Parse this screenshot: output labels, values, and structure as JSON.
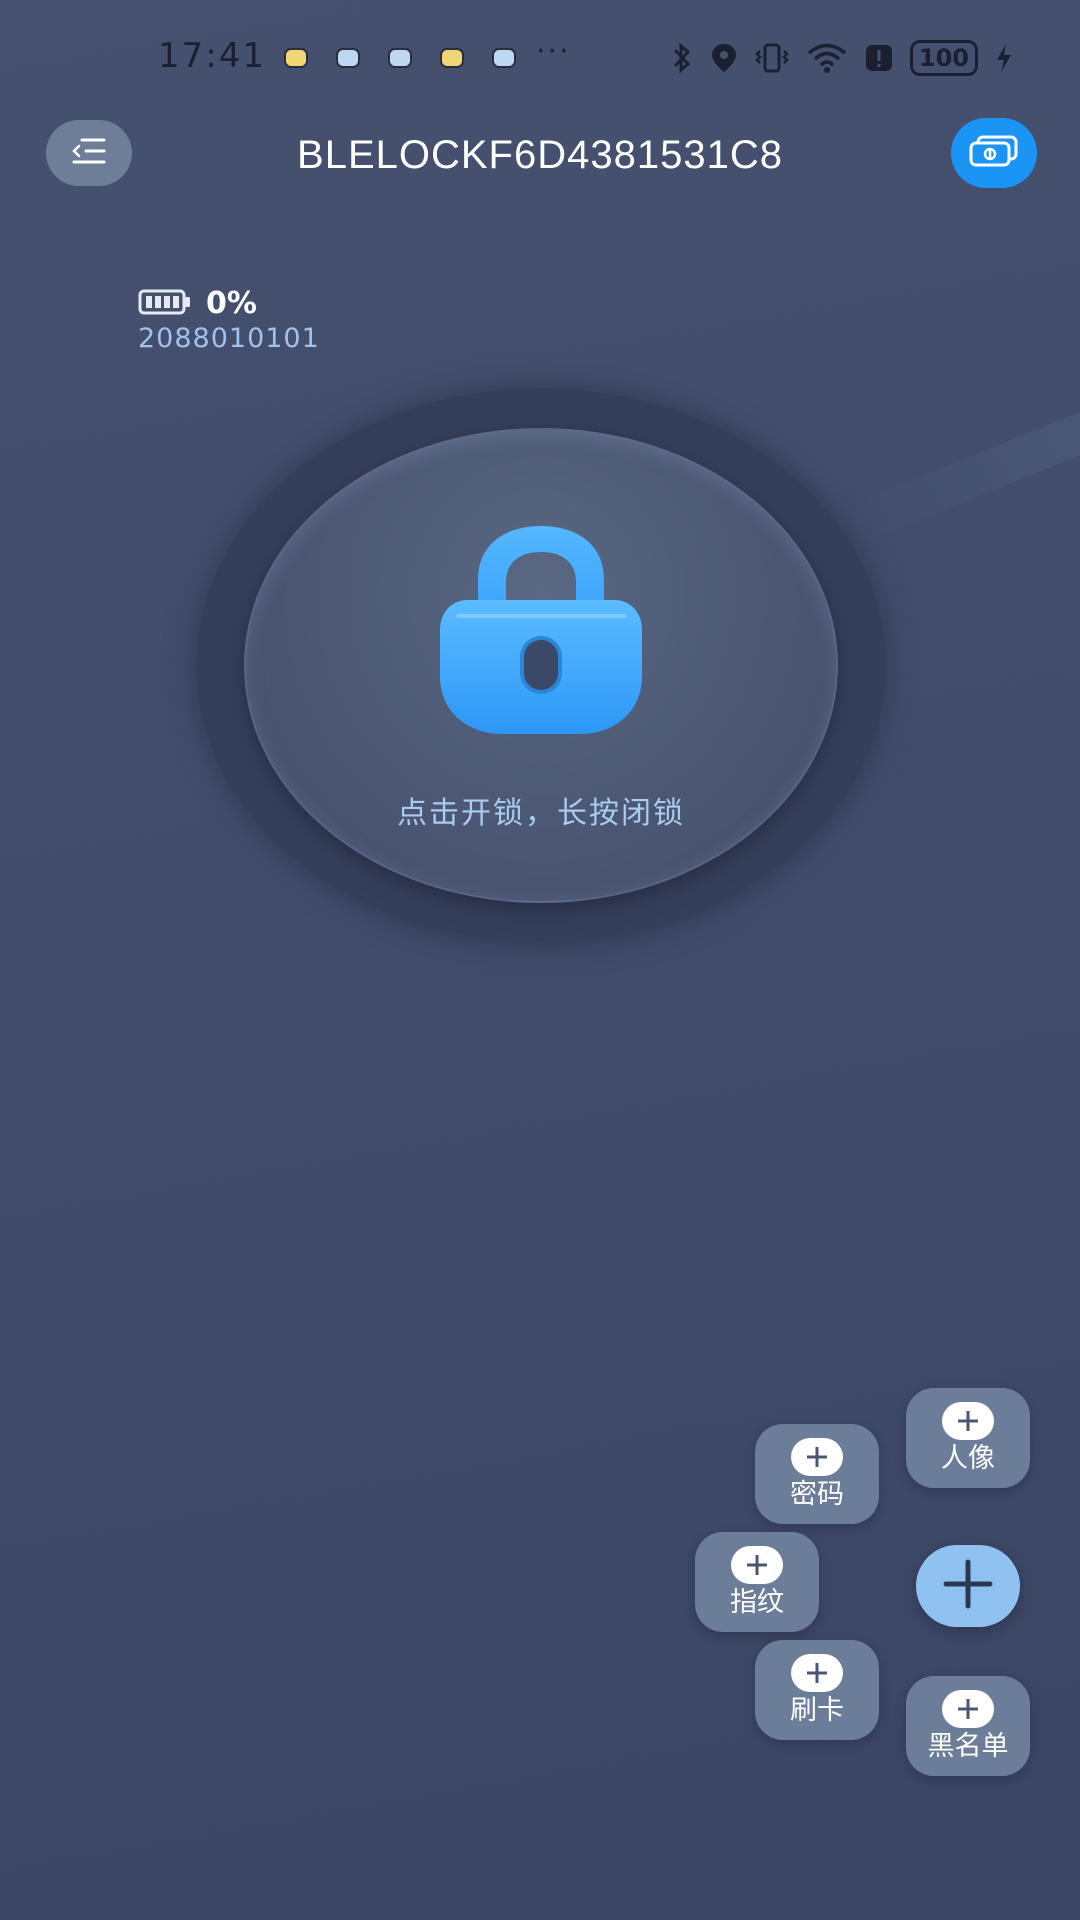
{
  "status_bar": {
    "time": "17:41",
    "more": "···",
    "battery_level": "100"
  },
  "header": {
    "title": "BLELOCKF6D4381531C8",
    "menu_icon": "menu-list-icon",
    "switch_icon": "switch-device-icon"
  },
  "device": {
    "battery_percent": "0%",
    "battery_icon": "battery-icon",
    "number": "2088010101"
  },
  "lock": {
    "icon": "lock-icon",
    "hint": "点击开锁，长按闭锁"
  },
  "fab_menu": {
    "items": [
      {
        "label": "人像",
        "icon": "plus-icon"
      },
      {
        "label": "密码",
        "icon": "plus-icon"
      },
      {
        "label": "指纹",
        "icon": "plus-icon"
      },
      {
        "label": "刷卡",
        "icon": "plus-icon"
      },
      {
        "label": "黑名单",
        "icon": "plus-icon"
      }
    ],
    "main_icon": "plus-icon"
  },
  "colors": {
    "background": "#414c6b",
    "accent": "#1b95f5",
    "lock_blue": "#3aa8ff",
    "hint_text": "#a9ccf2",
    "fab_item": "#6c7d99",
    "fab_main": "#8fc2f0"
  }
}
